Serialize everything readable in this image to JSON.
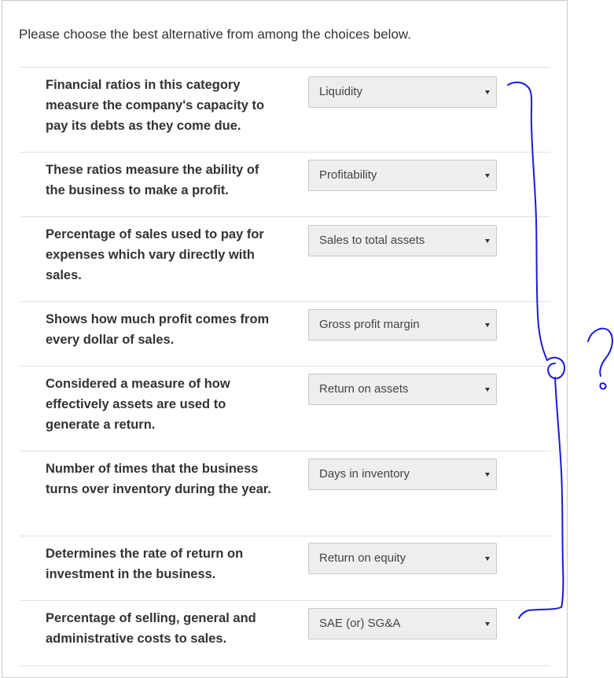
{
  "instructions": "Please choose the best alternative from among the choices below.",
  "items": [
    {
      "question": "Financial ratios in this category measure the company's capacity to pay its debts as they come due.",
      "selected": "Liquidity"
    },
    {
      "question": "These ratios measure the ability of the business to make a profit.",
      "selected": "Profitability"
    },
    {
      "question": "Percentage of sales used to pay for expenses which vary directly with sales.",
      "selected": "Sales to total assets"
    },
    {
      "question": "Shows how much profit comes from every dollar of sales.",
      "selected": "Gross profit margin"
    },
    {
      "question": "Considered a measure of how effectively assets are used to generate a return.",
      "selected": "Return on assets"
    },
    {
      "question": "Number of times that the business turns over inventory during the year.",
      "selected": "Days in inventory"
    },
    {
      "question": "Determines the rate of return on investment in the business.",
      "selected": "Return on equity"
    },
    {
      "question": "Percentage of selling, general and administrative costs to sales.",
      "selected": "SAE (or) SG&A"
    }
  ],
  "colors": {
    "annotation_ink": "#1a1adb",
    "select_background": "#eeeeee",
    "select_border": "#c8c8c8",
    "text": "#333333"
  },
  "icons": {
    "dropdown": "caret-down-icon"
  }
}
